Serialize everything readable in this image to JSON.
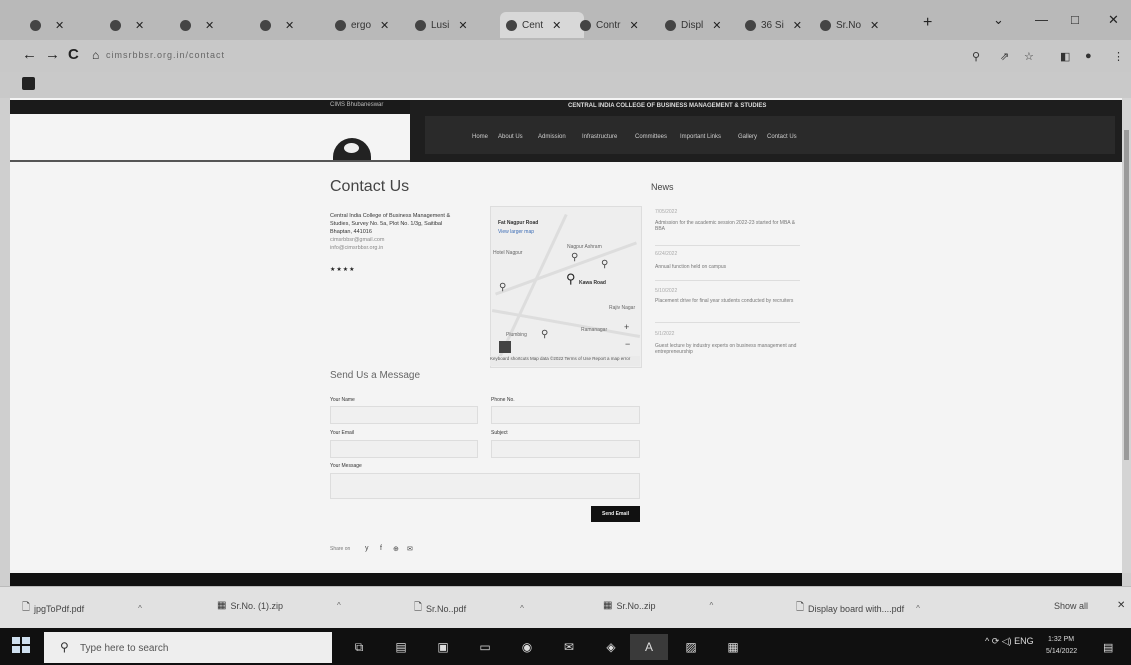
{
  "browser": {
    "tabs": [
      {
        "label": "",
        "icon": "page-icon"
      },
      {
        "label": "",
        "icon": "page-icon"
      },
      {
        "label": "",
        "icon": "page-icon"
      },
      {
        "label": "",
        "icon": "page-icon"
      },
      {
        "label": "ergo",
        "icon": "globe-icon"
      },
      {
        "label": "Lusi",
        "icon": "page-icon"
      },
      {
        "label": "Cent",
        "icon": "globe-icon"
      },
      {
        "label": "Contr",
        "icon": "globe-icon"
      },
      {
        "label": "Displ",
        "icon": "page-icon"
      },
      {
        "label": "36 Si",
        "icon": "globe-icon"
      },
      {
        "label": "Sr.No",
        "icon": "drive-icon"
      }
    ],
    "new_tab": "+",
    "window_controls": {
      "dropdown": "⌄",
      "minimize": "—",
      "maximize": "□",
      "close": "✕"
    },
    "nav": {
      "back": "←",
      "forward": "→",
      "reload": "C",
      "home": "⌂"
    },
    "url": "cimsrbbsr.org.in/contact",
    "right_icons": [
      "⚲",
      "⇗",
      "☆",
      "◧",
      "●",
      "⋮"
    ]
  },
  "site": {
    "top_strip": "CIMS Bhubaneswar",
    "header_title": "CENTRAL INDIA COLLEGE OF BUSINESS MANAGEMENT & STUDIES",
    "nav_items": [
      "Home",
      "About Us",
      "Admission",
      "Infrastructure",
      "Committees",
      "Important Links",
      "Gallery",
      "Contact Us"
    ],
    "contact_title": "Contact Us",
    "address_lines": [
      "Central India College of Business Management &",
      "Studies, Survey No. 5a, Plot No. 1/3g, Saitibal",
      "Bhaptan, 441016"
    ],
    "links": [
      "cimsrbbsr@gmail.com",
      "info@cimsrbbsr.org.in"
    ],
    "stars": "★★★★",
    "map": {
      "labels": [
        "Fat Nagpur Road",
        "View larger map",
        "Hotel Nagpur",
        "Nagpur Ashram",
        "Kawa Road",
        "Rajiv Nagar",
        "Plumbing",
        "Ramanagar"
      ],
      "footer": "Keyboard shortcuts   Map data ©2022   Terms of Use   Report a map error"
    },
    "news": {
      "title": "News",
      "items": [
        {
          "date": "7/05/2022",
          "text": "Admission for the academic session 2022-23 started for MBA & BBA"
        },
        {
          "date": "6/24/2022",
          "text": "Annual function held on campus"
        },
        {
          "date": "5/10/2022",
          "text": "Placement drive for final year students conducted by recruiters"
        },
        {
          "date": "5/1/2022",
          "text": "Guest lecture by industry experts on business management and entrepreneurship"
        }
      ]
    },
    "form": {
      "title": "Send Us a Message",
      "name_label": "Your Name",
      "phone_label": "Phone No.",
      "email_label": "Your Email",
      "subject_label": "Subject",
      "message_label": "Your Message",
      "send_label": "Send Email"
    },
    "share": {
      "label": "Share on",
      "icons": [
        "y",
        "f",
        "⊕",
        "✉"
      ]
    }
  },
  "downloads": {
    "items": [
      {
        "name": "jpgToPdf.pdf",
        "icon": "pdf-icon"
      },
      {
        "name": "Sr.No. (1).zip",
        "icon": "zip-icon"
      },
      {
        "name": "Sr.No..pdf",
        "icon": "pdf-icon"
      },
      {
        "name": "Sr.No..zip",
        "icon": "zip-icon"
      },
      {
        "name": "Display board with....pdf",
        "icon": "pdf-icon"
      }
    ],
    "show_all": "Show all"
  },
  "taskbar": {
    "search_placeholder": "Type here to search",
    "time": "1:32 PM",
    "date": "5/14/2022",
    "tray": "^ ⟳ ◁) ENG"
  }
}
